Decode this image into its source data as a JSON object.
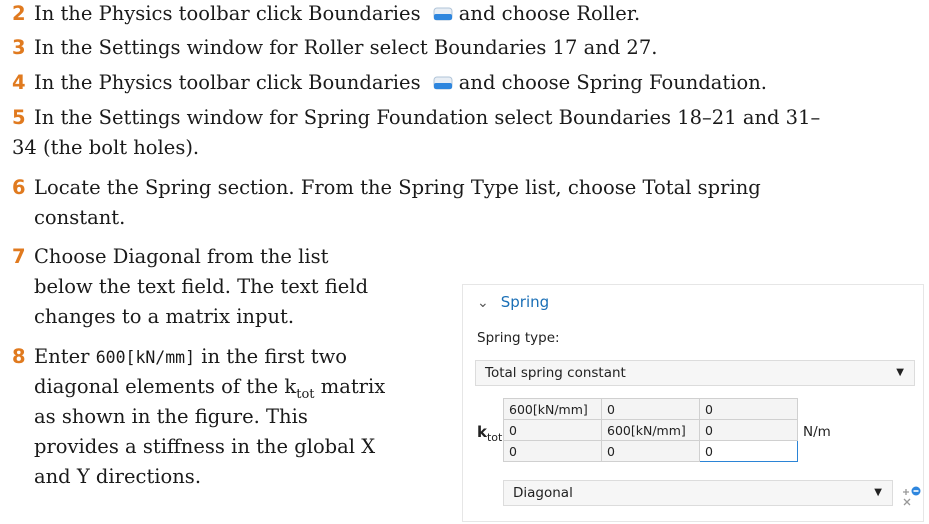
{
  "steps": [
    {
      "num": "2",
      "pre": "In the Physics toolbar click Boundaries",
      "post": "and choose Roller."
    },
    {
      "num": "3",
      "text": "In the Settings window for Roller select Boundaries 17 and 27."
    },
    {
      "num": "4",
      "pre": "In the Physics toolbar click Boundaries",
      "post": "and choose Spring Foundation."
    },
    {
      "num": "5",
      "line1": "In the Settings window for Spring Foundation select Boundaries 18–21 and 31–",
      "line2": "34 (the bolt holes)."
    },
    {
      "num": "6",
      "line1": "Locate the Spring section. From the Spring Type list, choose Total spring",
      "line2": "constant."
    },
    {
      "num": "7",
      "line1": "Choose Diagonal from the list",
      "line2": "below the text field. The text field",
      "line3": "changes to a matrix input."
    },
    {
      "num": "8",
      "enter": "Enter",
      "code": "600[kN/mm]",
      "line1_rest": "in the first two",
      "line2_pre": "diagonal elements of the k",
      "line2_sub": "tot",
      "line2_post": "matrix",
      "line3": "as shown in the figure. This",
      "line4": "provides a stiffness in the global X",
      "line5": "and Y directions."
    }
  ],
  "panel": {
    "section": "Spring",
    "spring_type_label": "Spring type:",
    "spring_type_value": "Total spring constant",
    "k_symbol": "k",
    "k_sub": "tot",
    "matrix": [
      [
        "600[kN/mm]",
        "0",
        "0"
      ],
      [
        "0",
        "600[kN/mm]",
        "0"
      ],
      [
        "0",
        "0",
        "0"
      ]
    ],
    "unit": "N/m",
    "matrix_type": "Diagonal"
  },
  "colors": {
    "step_number": "#e07a1f",
    "section_header": "#1a6fb6",
    "boundary_icon": "#2e86de"
  }
}
